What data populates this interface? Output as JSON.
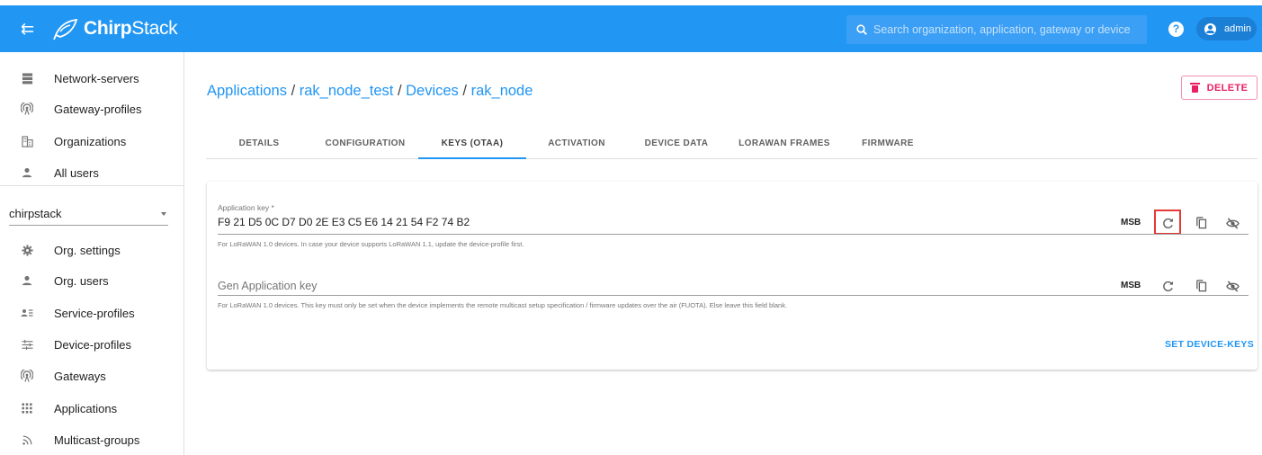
{
  "header": {
    "brand_prefix": "Chirp",
    "brand_suffix": "Stack",
    "search_placeholder": "Search organization, application, gateway or device",
    "help_label": "?",
    "user_label": "admin",
    "accent_color": "#2196f3"
  },
  "sidebar": {
    "admin_items": [
      {
        "label": "Network-servers",
        "icon": "server-icon"
      },
      {
        "label": "Gateway-profiles",
        "icon": "gateway-antenna-icon"
      },
      {
        "label": "Organizations",
        "icon": "domain-icon"
      },
      {
        "label": "All users",
        "icon": "person-icon"
      }
    ],
    "organization_select": "chirpstack",
    "org_items": [
      {
        "label": "Org. settings",
        "icon": "gear-icon"
      },
      {
        "label": "Org. users",
        "icon": "person-icon"
      },
      {
        "label": "Service-profiles",
        "icon": "account-details-icon"
      },
      {
        "label": "Device-profiles",
        "icon": "tune-icon"
      },
      {
        "label": "Gateways",
        "icon": "gateway-antenna-icon"
      },
      {
        "label": "Applications",
        "icon": "apps-grid-icon"
      },
      {
        "label": "Multicast-groups",
        "icon": "rss-icon"
      }
    ]
  },
  "breadcrumb": {
    "items": [
      "Applications",
      "rak_node_test",
      "Devices",
      "rak_node"
    ],
    "separator": "/"
  },
  "delete_label": "DELETE",
  "tabs": [
    {
      "label": "DETAILS"
    },
    {
      "label": "CONFIGURATION"
    },
    {
      "label": "KEYS (OTAA)",
      "active": true
    },
    {
      "label": "ACTIVATION"
    },
    {
      "label": "DEVICE DATA"
    },
    {
      "label": "LORAWAN FRAMES"
    },
    {
      "label": "FIRMWARE"
    }
  ],
  "keys_form": {
    "app_key": {
      "label": "Application key *",
      "value": "F9 21 D5 0C D7 D0 2E E3 C5 E6 14 21 54 F2 74 B2",
      "byte_order": "MSB",
      "helper": "For LoRaWAN 1.0 devices. In case your device supports LoRaWAN 1.1, update the device-profile first."
    },
    "gen_app_key": {
      "placeholder": "Gen Application key",
      "byte_order": "MSB",
      "helper": "For LoRaWAN 1.0 devices. This key must only be set when the device implements the remote multicast setup specification / firmware updates over the air (FUOTA). Else leave this field blank."
    },
    "submit_label": "SET DEVICE-KEYS",
    "highlight_color": "#e53935"
  }
}
